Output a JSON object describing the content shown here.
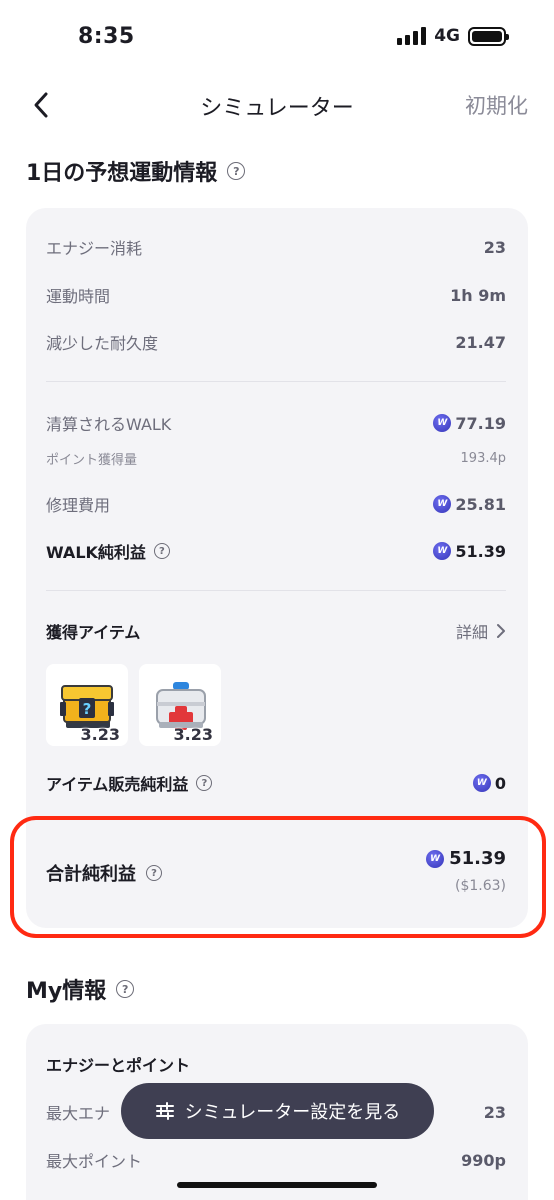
{
  "status_bar": {
    "time": "8:35",
    "network": "4G"
  },
  "nav": {
    "title": "シミュレーター",
    "reset_label": "初期化"
  },
  "daily_section": {
    "title": "1日の予想運動情報",
    "energy_label": "エナジー消耗",
    "energy_value": "23",
    "time_label": "運動時間",
    "time_value": "1h 9m",
    "durability_label": "減少した耐久度",
    "durability_value": "21.47",
    "settled_walk_label": "清算されるWALK",
    "settled_walk_value": "77.19",
    "points_label": "ポイント獲得量",
    "points_value": "193.4p",
    "repair_label": "修理費用",
    "repair_value": "25.81",
    "walk_profit_label": "WALK純利益",
    "walk_profit_value": "51.39",
    "items_label": "獲得アイテム",
    "details_label": "詳細",
    "items": [
      {
        "icon": "mystery-box-icon",
        "qty": "3.23"
      },
      {
        "icon": "repair-kit-icon",
        "qty": "3.23"
      }
    ],
    "item_sales_label": "アイテム販売純利益",
    "item_sales_value": "0",
    "total_label": "合計純利益",
    "total_value": "51.39",
    "total_usd": "($1.63)"
  },
  "my_section": {
    "title": "My情報",
    "group_label": "エナジーとポイント",
    "max_energy_label": "最大エナ",
    "max_energy_value": "23",
    "max_points_label": "最大ポイント",
    "max_points_value": "990p"
  },
  "toast": {
    "label": "シミュレーター設定を見る"
  },
  "colors": {
    "accent": "#ff2a12",
    "coin": "#3c3cc8",
    "card": "#f4f4f7",
    "toast": "#3f3f52"
  }
}
